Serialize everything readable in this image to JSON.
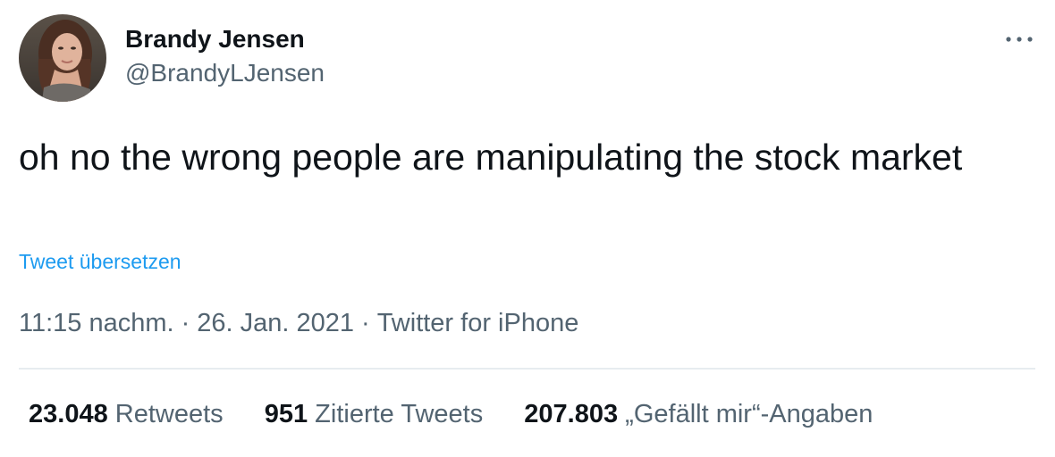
{
  "user": {
    "display_name": "Brandy Jensen",
    "handle": "@BrandyLJensen",
    "avatar_icon": "profile-photo"
  },
  "more_icon": "ellipsis-icon",
  "tweet": {
    "text": "oh no the wrong people are manipulating the stock market",
    "translate_link": "Tweet übersetzen"
  },
  "meta": {
    "time": "11:15 nachm.",
    "separator": "·",
    "date": "26. Jan. 2021",
    "source": "Twitter for iPhone"
  },
  "stats": {
    "retweets_count": "23.048",
    "retweets_label": "Retweets",
    "quotes_count": "951",
    "quotes_label": "Zitierte Tweets",
    "likes_count": "207.803",
    "likes_label": "„Gefällt mir“-Angaben"
  },
  "colors": {
    "text": "#0f1419",
    "secondary": "#536471",
    "link": "#1d9bf0",
    "divider": "#e7ecf0"
  }
}
